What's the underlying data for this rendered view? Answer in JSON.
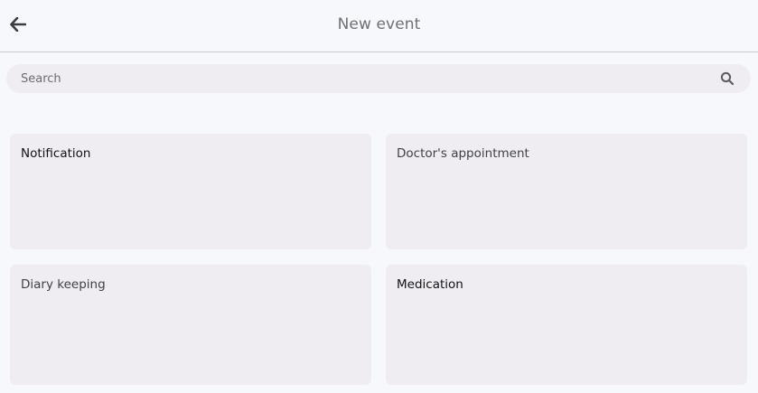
{
  "header": {
    "title": "New event",
    "back_icon": "arrow-left-icon"
  },
  "search": {
    "placeholder": "Search",
    "value": "",
    "icon": "search-icon"
  },
  "event_types": [
    {
      "label": "Notification"
    },
    {
      "label": "Doctor's appointment"
    },
    {
      "label": "Diary keeping"
    },
    {
      "label": "Medication"
    }
  ],
  "colors": {
    "background": "#f7f8fc",
    "card": "#efedf2",
    "divider": "#c9cace",
    "title": "#6f6f74"
  }
}
